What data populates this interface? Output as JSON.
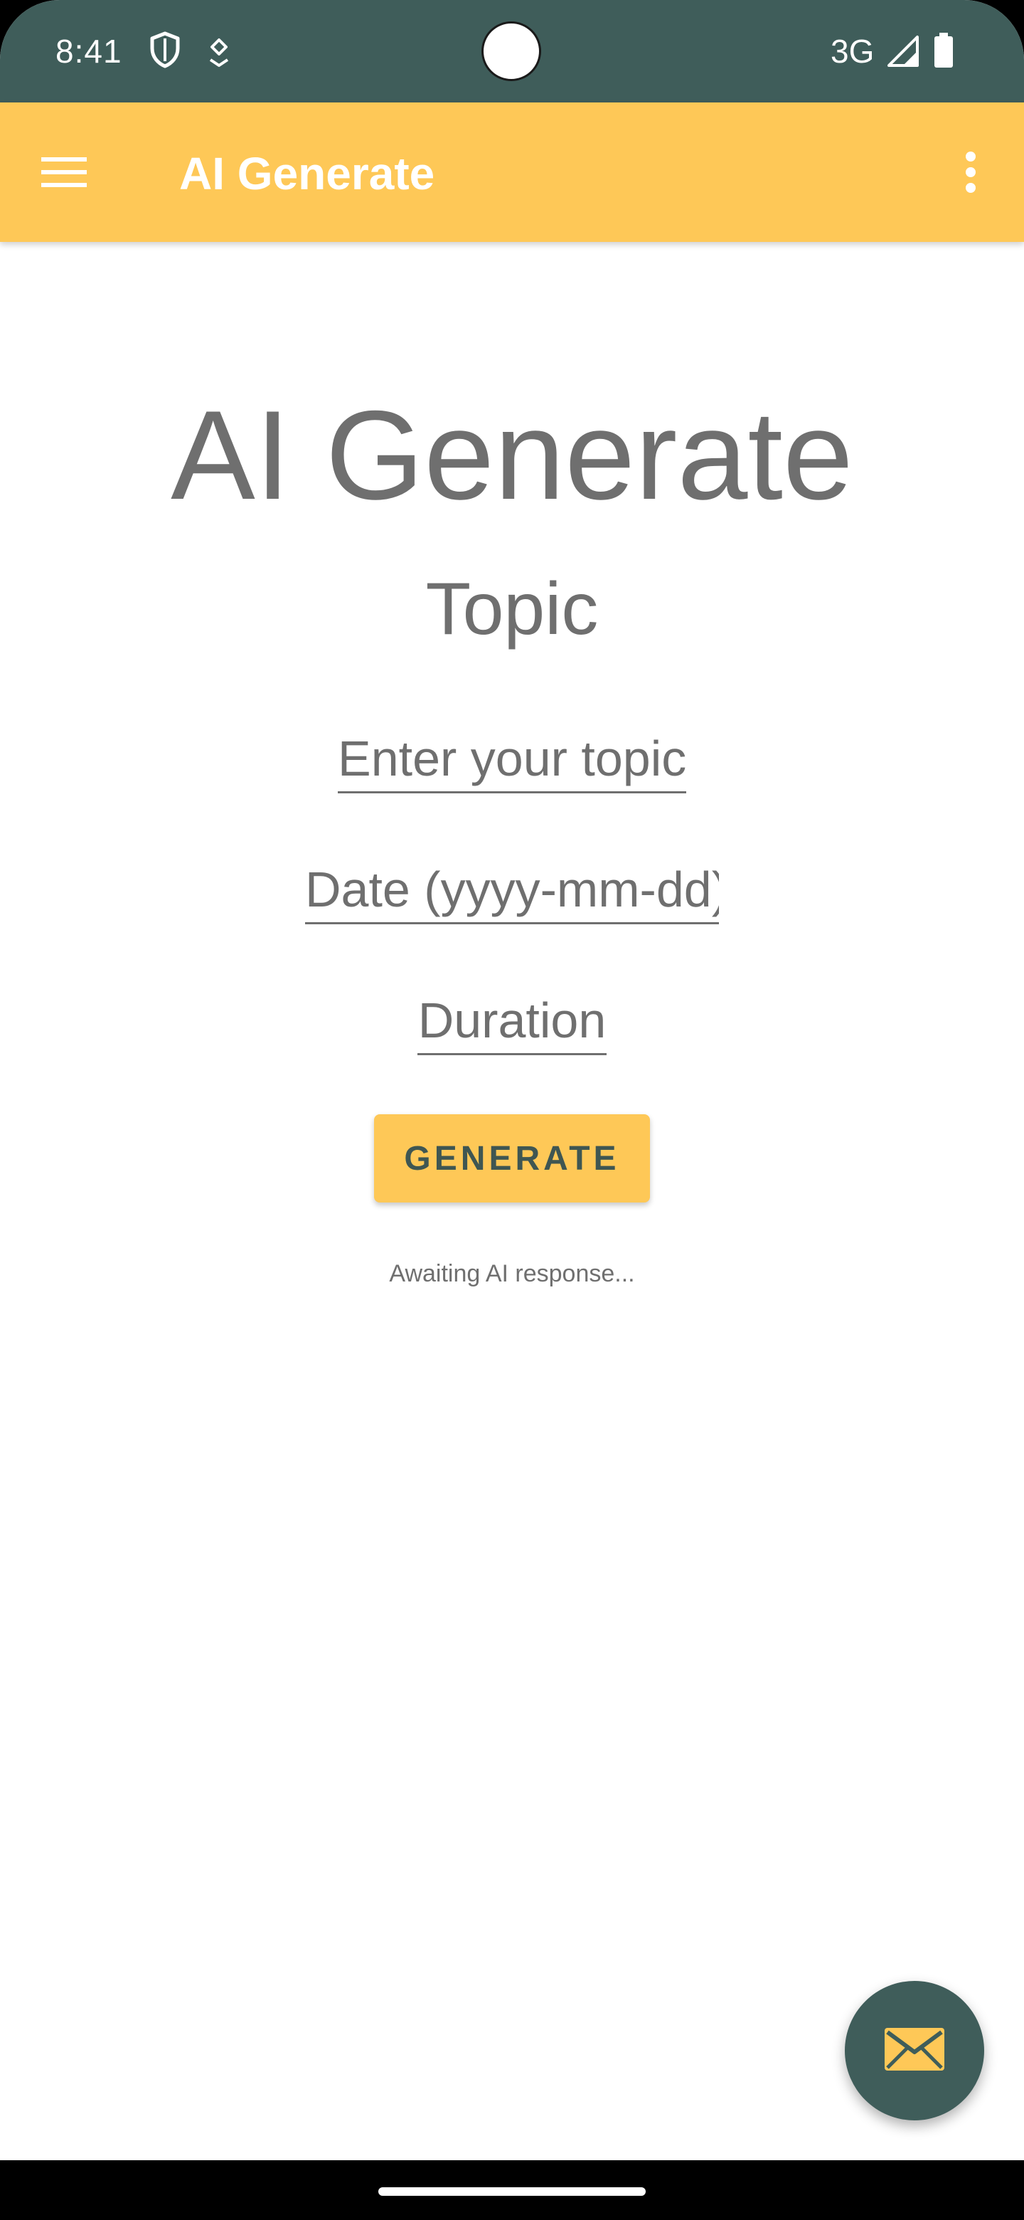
{
  "status_bar": {
    "time": "8:41",
    "network": "3G",
    "icons": [
      "shield-icon",
      "location-pin-icon",
      "signal-icon",
      "battery-icon"
    ]
  },
  "app_bar": {
    "title": "AI Generate",
    "menu_icon": "hamburger-menu-icon",
    "overflow_icon": "more-vert-icon"
  },
  "main": {
    "heading": "AI Generate",
    "subheading": "Topic",
    "topic_field": {
      "placeholder": "Enter your topic",
      "value": ""
    },
    "date_field": {
      "placeholder": "Date (yyyy-mm-dd)",
      "value": ""
    },
    "duration_field": {
      "placeholder": "Duration",
      "value": ""
    },
    "generate_label": "GENERATE",
    "status": "Awaiting AI response..."
  },
  "fab": {
    "icon": "email-icon"
  },
  "colors": {
    "status_bar": "#3f5d5a",
    "app_bar": "#fec857",
    "accent": "#fec857",
    "text_gray": "#6f6f6f"
  }
}
